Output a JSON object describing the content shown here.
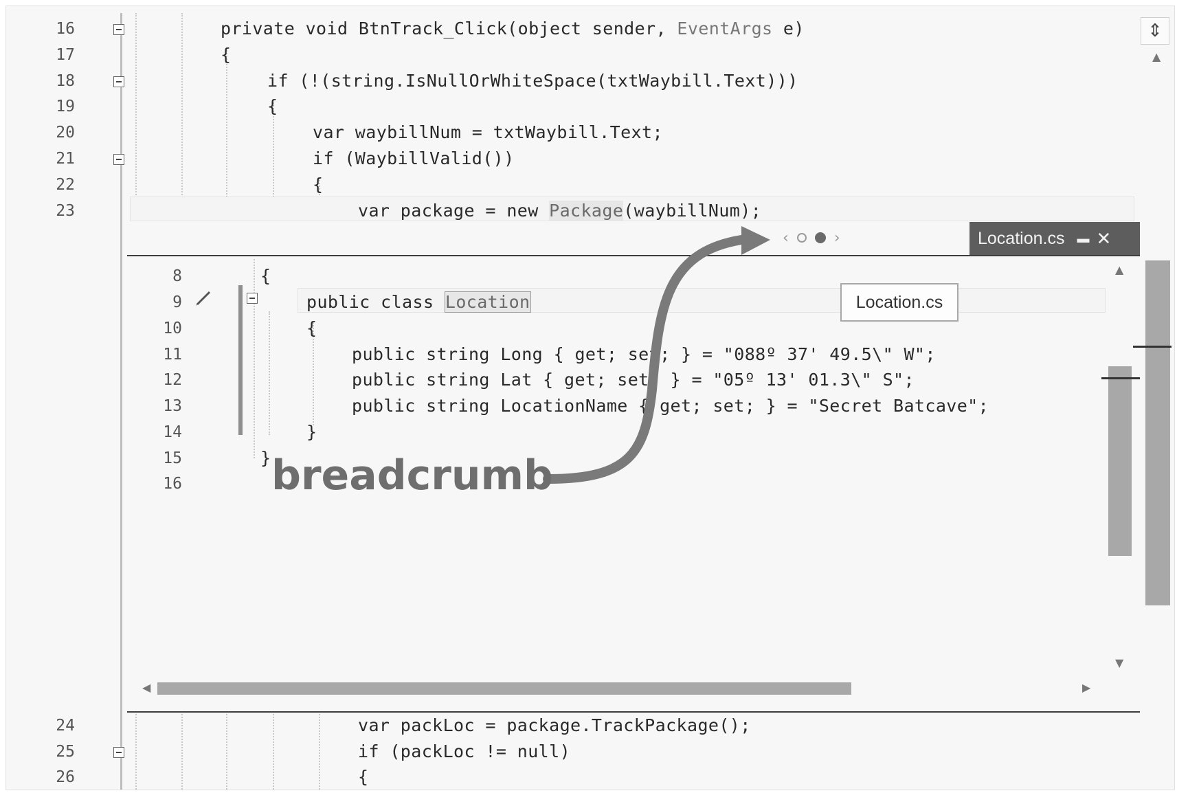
{
  "editor": {
    "top_lines": [
      {
        "num": "16",
        "code": "private void BtnTrack_Click(object sender, ",
        "type": "EventArgs",
        "rest": " e)"
      },
      {
        "num": "17",
        "code": "{"
      },
      {
        "num": "18",
        "code": "if (!(string.IsNullOrWhiteSpace(txtWaybill.Text)))"
      },
      {
        "num": "19",
        "code": "{"
      },
      {
        "num": "20",
        "code": "var waybillNum = txtWaybill.Text;"
      },
      {
        "num": "21",
        "code": "if (WaybillValid())"
      },
      {
        "num": "22",
        "code": "{"
      },
      {
        "num": "23",
        "pre": "var package = new ",
        "hl": "Package",
        "post": "(waybillNum);"
      }
    ],
    "bottom_lines": [
      {
        "num": "24",
        "code": "var packLoc = package.TrackPackage();"
      },
      {
        "num": "25",
        "code": "if (packLoc != null)"
      },
      {
        "num": "26",
        "code": "{"
      }
    ]
  },
  "peek": {
    "tab_title": "Location.cs",
    "pin_icon": "pin-icon",
    "close_icon": "close-icon",
    "nav_prev": "‹",
    "nav_next": "›",
    "tooltip": "Location.cs",
    "lines": [
      {
        "num": "8",
        "code": "{"
      },
      {
        "num": "9",
        "pre": "public class ",
        "hl": "Location"
      },
      {
        "num": "10",
        "code": "{"
      },
      {
        "num": "11",
        "code": "public string Long { get; set; } = \"088º 37' 49.5\\\" W\";"
      },
      {
        "num": "12",
        "code": "public string Lat { get; set; } = \"05º 13' 01.3\\\" S\";"
      },
      {
        "num": "13",
        "code": "public string LocationName { get; set; } = \"Secret Batcave\";"
      },
      {
        "num": "14",
        "code": "}"
      },
      {
        "num": "15",
        "code": "}"
      },
      {
        "num": "16",
        "code": ""
      }
    ]
  },
  "annotation": {
    "label": "breadcrumb"
  }
}
